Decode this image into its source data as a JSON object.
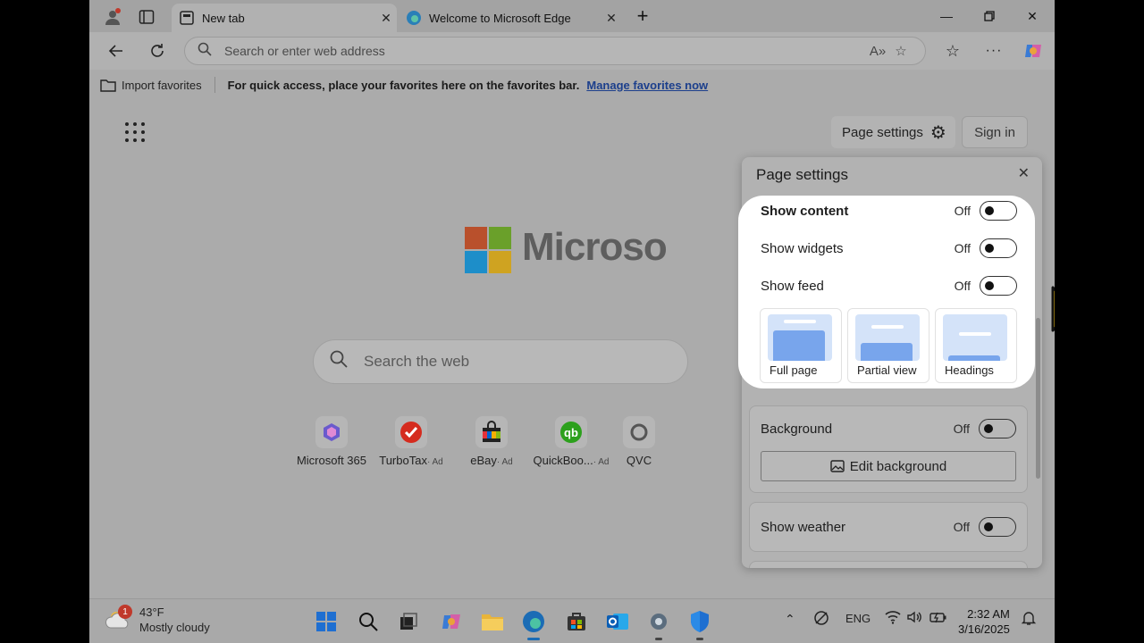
{
  "tabs": [
    {
      "title": "New tab",
      "active": true
    },
    {
      "title": "Welcome to Microsoft Edge",
      "active": false
    }
  ],
  "toolbar": {
    "address_placeholder": "Search or enter web address"
  },
  "favorites_bar": {
    "import_label": "Import favorites",
    "message": "For quick access, place your favorites here on the favorites bar.",
    "manage_link": "Manage favorites now"
  },
  "ntp": {
    "page_settings_label": "Page settings",
    "sign_in_label": "Sign in",
    "logo_text": "Microso",
    "search_placeholder": "Search the web",
    "quick_links": [
      {
        "label": "Microsoft 365",
        "ad": ""
      },
      {
        "label": "TurboTax",
        "ad": "· Ad"
      },
      {
        "label": "eBay",
        "ad": "· Ad"
      },
      {
        "label": "QuickBoo...",
        "ad": "· Ad"
      },
      {
        "label": "QVC",
        "ad": ""
      }
    ]
  },
  "settings_panel": {
    "title": "Page settings",
    "show_content": {
      "label": "Show content",
      "state": "Off"
    },
    "show_widgets": {
      "label": "Show widgets",
      "state": "Off"
    },
    "show_feed": {
      "label": "Show feed",
      "state": "Off"
    },
    "layout_options": [
      "Full page",
      "Partial view",
      "Headings"
    ],
    "background": {
      "label": "Background",
      "state": "Off",
      "edit_button": "Edit background"
    },
    "show_weather": {
      "label": "Show weather",
      "state": "Off"
    }
  },
  "taskbar": {
    "weather_temp": "43°F",
    "weather_desc": "Mostly cloudy",
    "weather_badge": "1",
    "language": "ENG",
    "time": "2:32 AM",
    "date": "3/16/2025"
  },
  "colors": {
    "highlight": "#ffffff",
    "cursor": "#f5c211",
    "toggle_knob": "#111111"
  }
}
